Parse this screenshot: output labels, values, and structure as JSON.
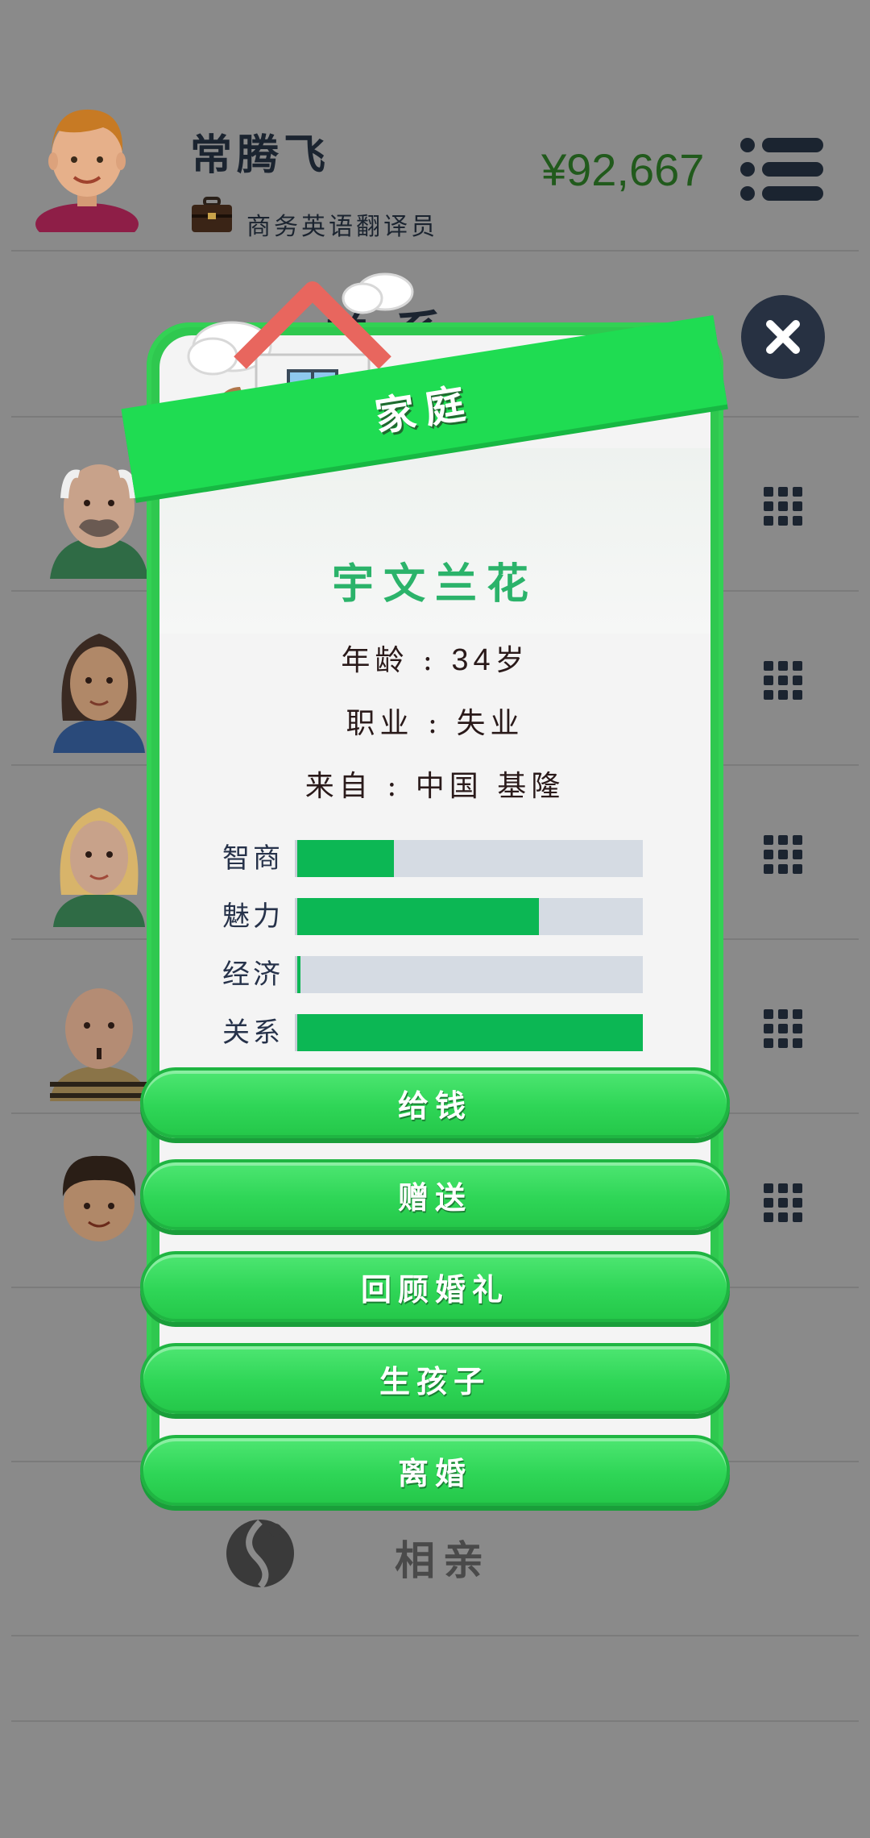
{
  "header": {
    "player_name": "常腾飞",
    "job_title": "商务英语翻译员",
    "money": "¥92,667"
  },
  "background": {
    "title": "关系",
    "bottom_action": "相亲"
  },
  "modal": {
    "banner_title": "家庭",
    "spouse_name": "宇文兰花",
    "age_label": "年龄",
    "age_value": "34",
    "age_unit": "岁",
    "job_label": "职业",
    "job_value": "失业",
    "from_label": "来自",
    "from_value": "中国 基隆",
    "separator": ":",
    "stats": [
      {
        "label": "智商",
        "value": 0.28
      },
      {
        "label": "魅力",
        "value": 0.7
      },
      {
        "label": "经济",
        "value": 0.01
      },
      {
        "label": "关系",
        "value": 1.0
      }
    ],
    "buttons": [
      "给钱",
      "赠送",
      "回顾婚礼",
      "生孩子",
      "离婚"
    ]
  },
  "colors": {
    "overlay_bg": "#8a8a8a",
    "modal_green": "#2fc84f",
    "banner_green": "#1fdc52",
    "stat_fill": "#0cb754",
    "stat_track": "#d5dbe3",
    "money_color": "#215a1c",
    "name_color": "#2bb36a"
  },
  "icons": {
    "player_avatar": "boy-avatar-icon",
    "job": "briefcase-icon",
    "menu": "menu-list-icon",
    "close": "close-icon",
    "row_action": "grid-icon",
    "blind_date": "couple-silhouette-icon",
    "house": "house-icon"
  }
}
